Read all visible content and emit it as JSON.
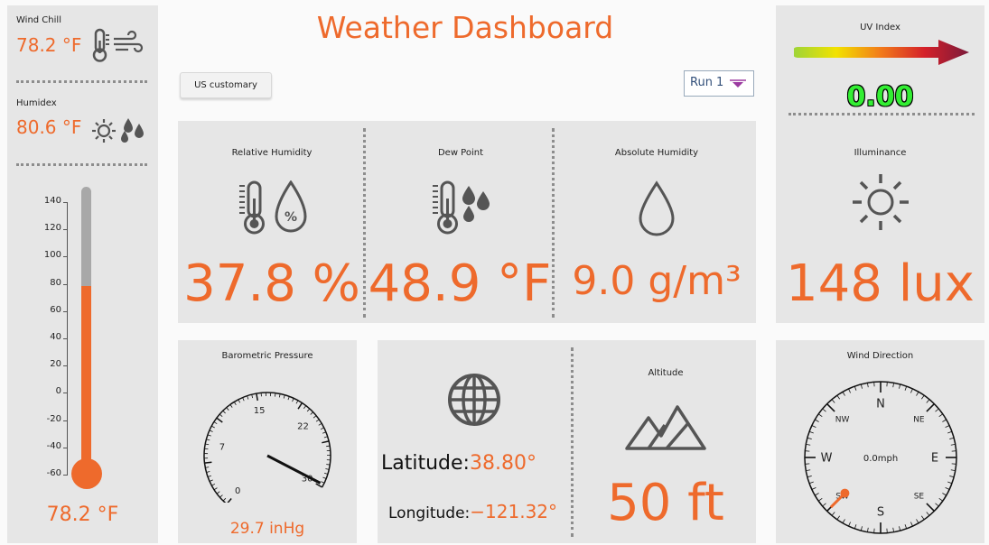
{
  "title": "Weather Dashboard",
  "units_button": "US customary",
  "run_select": "Run 1",
  "left": {
    "wind_chill_label": "Wind Chill",
    "wind_chill_value": "78.2 °F",
    "humidex_label": "Humidex",
    "humidex_value": "80.6 °F",
    "thermometer": {
      "ticks": [
        "140",
        "120",
        "100",
        "80",
        "60",
        "40",
        "20",
        "0",
        "-20",
        "-40",
        "-60"
      ],
      "min": -60,
      "max": 140,
      "level": 78.2,
      "value_label": "78.2 °F"
    }
  },
  "humidity": {
    "relative_label": "Relative Humidity",
    "relative_value": "37.8 %",
    "dew_label": "Dew Point",
    "dew_value": "48.9 °F",
    "absolute_label": "Absolute Humidity",
    "absolute_value": "9.0 g/m³"
  },
  "uv": {
    "label": "UV Index",
    "value": "0.00"
  },
  "illuminance": {
    "label": "Illuminance",
    "value": "148 lux"
  },
  "pressure": {
    "label": "Barometric Pressure",
    "ticks": [
      "0",
      "7",
      "15",
      "22",
      "30"
    ],
    "needle_value": 29.7,
    "value": "29.7 inHg"
  },
  "location": {
    "latitude_label": "Latitude:",
    "latitude_value": "38.80°",
    "longitude_label": "Longitude:",
    "longitude_value": "−121.32°",
    "altitude_label": "Altitude",
    "altitude_value": "50 ft"
  },
  "wind": {
    "label": "Wind Direction",
    "speed": "0.0mph",
    "direction_deg": 225,
    "points": {
      "N": "N",
      "NE": "NE",
      "E": "E",
      "SE": "SE",
      "S": "S",
      "SW": "SW",
      "W": "W",
      "NW": "NW"
    }
  },
  "colors": {
    "accent": "#ee6a2c",
    "panel": "#e6e6e6",
    "uv_value": "#33ee33",
    "icon": "#555555"
  }
}
